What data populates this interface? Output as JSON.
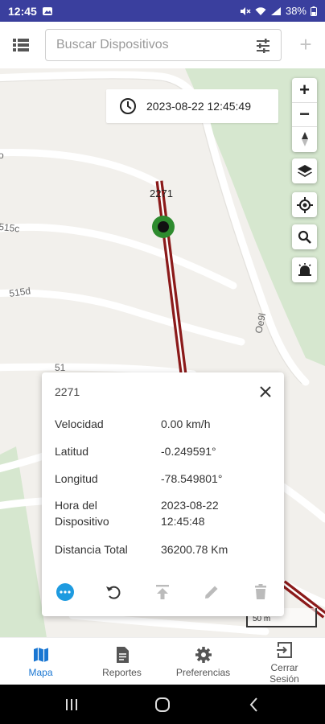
{
  "status_bar": {
    "time": "12:45",
    "battery": "38%"
  },
  "search": {
    "placeholder": "Buscar Dispositivos",
    "add_label": "+"
  },
  "map": {
    "timestamp": "2023-08-22 12:45:49",
    "device_label": "2271",
    "street_labels": [
      "515c",
      "515d",
      "Oe9l",
      "51"
    ],
    "scale_text": "50 m",
    "zoom_in": "+",
    "zoom_out": "−"
  },
  "popup": {
    "title": "2271",
    "rows": [
      {
        "key": "Velocidad",
        "value": "0.00 km/h"
      },
      {
        "key": "Latitud",
        "value": "-0.249591°"
      },
      {
        "key": "Longitud",
        "value": "-78.549801°"
      },
      {
        "key": "Hora del Dispositivo",
        "value": "2023-08-22 12:45:48"
      },
      {
        "key": "Distancia Total",
        "value": "36200.78 Km"
      }
    ]
  },
  "bottom_nav": {
    "items": [
      {
        "label": "Mapa",
        "icon": "map-icon",
        "active": true
      },
      {
        "label": "Reportes",
        "icon": "report-icon"
      },
      {
        "label": "Preferencias",
        "icon": "gear-icon"
      },
      {
        "label": "Cerrar Sesión",
        "icon": "logout-icon"
      }
    ]
  },
  "colors": {
    "status_bar": "#3a3f9e",
    "accent": "#1976d2",
    "route": "#8b1a1a",
    "marker": "#2e8b2e"
  }
}
